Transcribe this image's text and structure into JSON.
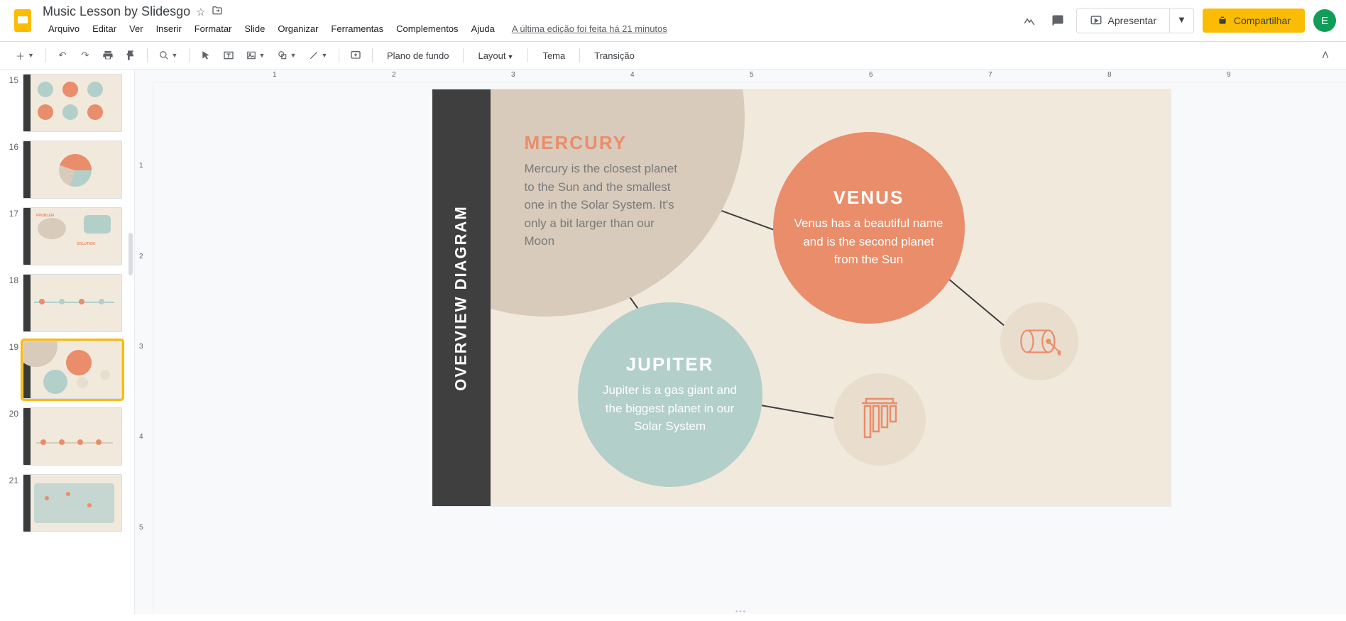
{
  "app": {
    "doc_title": "Music Lesson by Slidesgo",
    "edit_status": "A última edição foi feita há 21 minutos",
    "avatar_letter": "E"
  },
  "menu": {
    "file": "Arquivo",
    "edit": "Editar",
    "view": "Ver",
    "insert": "Inserir",
    "format": "Formatar",
    "slide": "Slide",
    "arrange": "Organizar",
    "tools": "Ferramentas",
    "addons": "Complementos",
    "help": "Ajuda"
  },
  "title_buttons": {
    "present": "Apresentar",
    "share": "Compartilhar"
  },
  "toolbar": {
    "background": "Plano de fundo",
    "layout": "Layout",
    "theme": "Tema",
    "transition": "Transição"
  },
  "ruler_h": [
    "1",
    "2",
    "3",
    "4",
    "5",
    "6",
    "7",
    "8",
    "9"
  ],
  "ruler_v": [
    "1",
    "2",
    "3",
    "4",
    "5"
  ],
  "thumbnails": {
    "visible_numbers": [
      "15",
      "16",
      "17",
      "18",
      "19",
      "20",
      "21"
    ],
    "selected": "19"
  },
  "slide": {
    "sidebar_label": "OVERVIEW DIAGRAM",
    "mercury": {
      "title": "MERCURY",
      "body": "Mercury is the closest planet to the Sun and the smallest one in the Solar System. It's only a bit larger than our Moon"
    },
    "venus": {
      "title": "VENUS",
      "body": "Venus has a beautiful name and is the second planet from the Sun"
    },
    "jupiter": {
      "title": "JUPITER",
      "body": "Jupiter is a gas giant and the biggest planet in our Solar System"
    }
  },
  "colors": {
    "slide_bg": "#f2e9dd",
    "beige": "#d8cbbb",
    "orange": "#e98d6b",
    "teal": "#b2cfca",
    "dark": "#3f3f3f",
    "accent": "#fbbc04"
  },
  "chart_data": {
    "type": "diagram",
    "title": "OVERVIEW DIAGRAM",
    "nodes": [
      {
        "id": "mercury",
        "label": "MERCURY",
        "description": "Mercury is the closest planet to the Sun and the smallest one in the Solar System. It's only a bit larger than our Moon",
        "color": "#d8cbbb"
      },
      {
        "id": "venus",
        "label": "VENUS",
        "description": "Venus has a beautiful name and is the second planet from the Sun",
        "color": "#e98d6b"
      },
      {
        "id": "jupiter",
        "label": "JUPITER",
        "description": "Jupiter is a gas giant and the biggest planet in our Solar System",
        "color": "#b2cfca"
      },
      {
        "id": "drum-icon",
        "label": "drum",
        "color": "#e9ddcd"
      },
      {
        "id": "chime-icon",
        "label": "wind chimes",
        "color": "#e9ddcd"
      }
    ],
    "edges": [
      [
        "mercury",
        "venus"
      ],
      [
        "mercury",
        "jupiter"
      ],
      [
        "venus",
        "drum-icon"
      ],
      [
        "jupiter",
        "chime-icon"
      ]
    ]
  }
}
